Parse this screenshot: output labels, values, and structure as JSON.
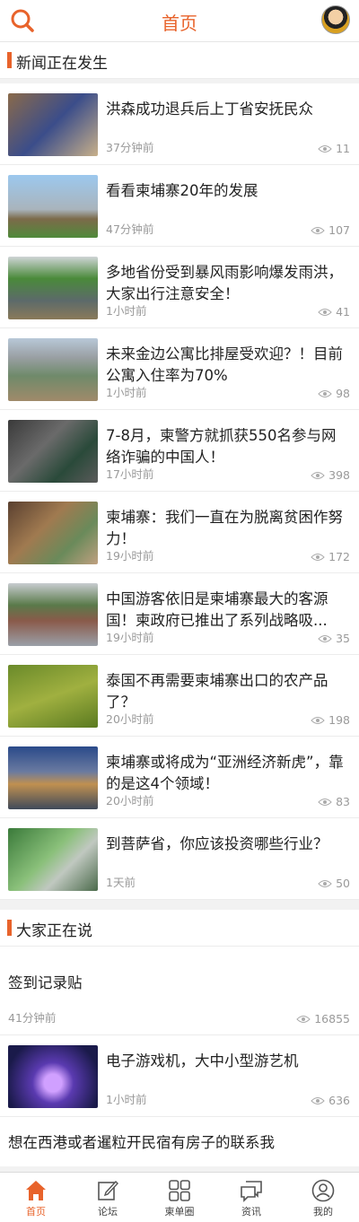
{
  "header": {
    "title": "首页",
    "search_icon": "search-icon",
    "avatar": "user-avatar"
  },
  "section_news": {
    "label": "新闻正在发生",
    "items": [
      {
        "title": "洪森成功退兵后上丁省安抚民众",
        "time": "37分钟前",
        "views": "11"
      },
      {
        "title": "看看柬埔寨20年的发展",
        "time": "47分钟前",
        "views": "107"
      },
      {
        "title": "多地省份受到暴风雨影响爆发雨洪，大家出行注意安全！",
        "time": "1小时前",
        "views": "41"
      },
      {
        "title": "未来金边公寓比排屋受欢迎？！目前公寓入住率为70%",
        "time": "1小时前",
        "views": "98"
      },
      {
        "title": "7-8月，柬警方就抓获550名参与网络诈骗的中国人！",
        "time": "17小时前",
        "views": "398"
      },
      {
        "title": "柬埔寨：我们一直在为脱离贫困作努力！",
        "time": "19小时前",
        "views": "172"
      },
      {
        "title": "中国游客依旧是柬埔寨最大的客源国！柬政府已推出了系列战略吸...",
        "time": "19小时前",
        "views": "35"
      },
      {
        "title": "泰国不再需要柬埔寨出口的农产品了？",
        "time": "20小时前",
        "views": "198"
      },
      {
        "title": "柬埔寨或将成为“亚洲经济新虎”，靠的是这4个领域！",
        "time": "20小时前",
        "views": "83"
      },
      {
        "title": "到菩萨省，你应该投资哪些行业？",
        "time": "1天前",
        "views": "50"
      }
    ]
  },
  "section_talk": {
    "label": "大家正在说",
    "posts": [
      {
        "title": "签到记录贴",
        "time": "41分钟前",
        "views": "16855"
      },
      {
        "title": "电子游戏机，大中小型游艺机",
        "time": "1小时前",
        "views": "636"
      },
      {
        "title": "想在西港或者暹粒开民宿有房子的联系我"
      }
    ]
  },
  "tabbar": [
    {
      "label": "首页",
      "icon": "home-icon"
    },
    {
      "label": "论坛",
      "icon": "edit-icon"
    },
    {
      "label": "柬单圈",
      "icon": "grid-icon"
    },
    {
      "label": "资讯",
      "icon": "chat-icon"
    },
    {
      "label": "我的",
      "icon": "user-icon"
    }
  ],
  "colors": {
    "accent": "#e8632b",
    "text": "#222222",
    "muted": "#9a9a9a"
  }
}
